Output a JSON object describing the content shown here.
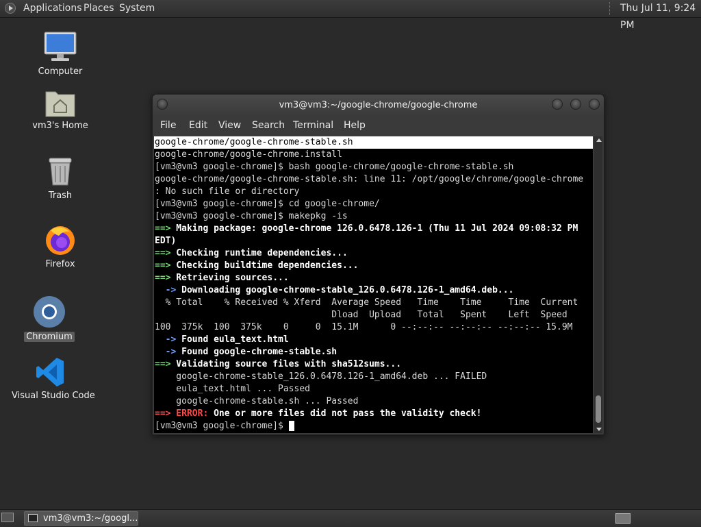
{
  "top_panel": {
    "applications": "Applications",
    "places": "Places",
    "system": "System",
    "clock": "Thu Jul 11,  9:24 PM"
  },
  "desktop": {
    "computer": "Computer",
    "home": "vm3's Home",
    "trash": "Trash",
    "firefox": "Firefox",
    "chromium": "Chromium",
    "vscode": "Visual Studio Code"
  },
  "window": {
    "title": "vm3@vm3:~/google-chrome/google-chrome",
    "menu": {
      "file": "File",
      "edit": "Edit",
      "view": "View",
      "search": "Search",
      "terminal": "Terminal",
      "help": "Help"
    }
  },
  "terminal": {
    "l1": "google-chrome/google-chrome-stable.sh",
    "l2": "google-chrome/google-chrome.install",
    "l3": "[vm3@vm3 google-chrome]$ bash google-chrome/google-chrome-stable.sh",
    "l4": "google-chrome/google-chrome-stable.sh: line 11: /opt/google/chrome/google-chrome",
    "l5": ": No such file or directory",
    "l6": "[vm3@vm3 google-chrome]$ cd google-chrome/",
    "l7": "[vm3@vm3 google-chrome]$ makepkg -is",
    "arrow": "==>",
    "sub_arrow": "  ->",
    "l8": " Making package: google-chrome 126.0.6478.126-1 (Thu 11 Jul 2024 09:08:32 PM",
    "l9": "EDT)",
    "l10": " Checking runtime dependencies...",
    "l11": " Checking buildtime dependencies...",
    "l12": " Retrieving sources...",
    "l13": " Downloading google-chrome-stable_126.0.6478.126-1_amd64.deb...",
    "l14": "  % Total    % Received % Xferd  Average Speed   Time    Time     Time  Current",
    "l15": "                                 Dload  Upload   Total   Spent    Left  Speed",
    "l16": "100  375k  100  375k    0     0  15.1M      0 --:--:-- --:--:-- --:--:-- 15.9M",
    "l17": " Found eula_text.html",
    "l18": " Found google-chrome-stable.sh",
    "l19": " Validating source files with sha512sums...",
    "l20": "    google-chrome-stable_126.0.6478.126-1_amd64.deb ... FAILED",
    "l21": "    eula_text.html ... Passed",
    "l22": "    google-chrome-stable.sh ... Passed",
    "error_label": " ERROR:",
    "l23": " One or more files did not pass the validity check!",
    "prompt": "[vm3@vm3 google-chrome]$ "
  },
  "taskbar": {
    "task_label": "vm3@vm3:~/googl..."
  }
}
